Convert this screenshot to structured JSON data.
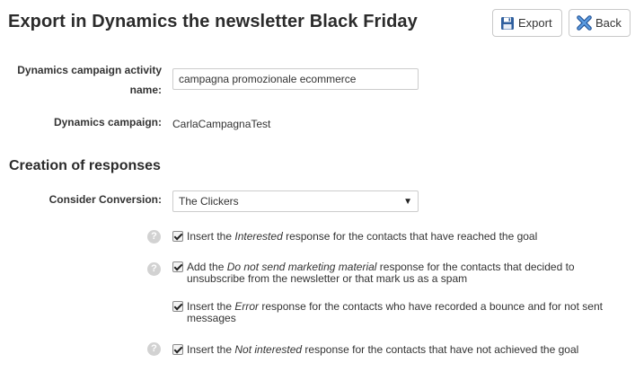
{
  "header": {
    "title": "Export in Dynamics the newsletter Black Friday",
    "export_label": "Export",
    "back_label": "Back"
  },
  "form": {
    "activity_name_label_1": "Dynamics campaign activity",
    "activity_name_label_2": "name:",
    "activity_name_value": "campagna promozionale ecommerce",
    "campaign_label": "Dynamics campaign:",
    "campaign_value": "CarlaCampagnaTest"
  },
  "responses": {
    "section_title": "Creation of responses",
    "conversion_label": "Consider Conversion:",
    "conversion_selected": "The Clickers",
    "help_glyph": "?",
    "options": [
      {
        "before": "Insert the ",
        "emph": "Interested",
        "after": " response for the contacts that have reached the goal",
        "checked": true
      },
      {
        "before": "Add the ",
        "emph": "Do not send marketing material",
        "after": " response for the contacts that decided to unsubscribe from the newsletter or that mark us as a spam",
        "checked": true
      },
      {
        "before": "Insert the ",
        "emph": "Error",
        "after": " response for the contacts who have recorded a bounce and for not sent messages",
        "checked": true
      },
      {
        "before": "Insert the ",
        "emph": "Not interested",
        "after": " response for the contacts that have not achieved the goal",
        "checked": true
      }
    ]
  },
  "icons": {
    "export": "floppy-disk-icon",
    "back": "close-x-icon",
    "back_color": "#3a79c8",
    "export_color": "#2f5f9e"
  }
}
